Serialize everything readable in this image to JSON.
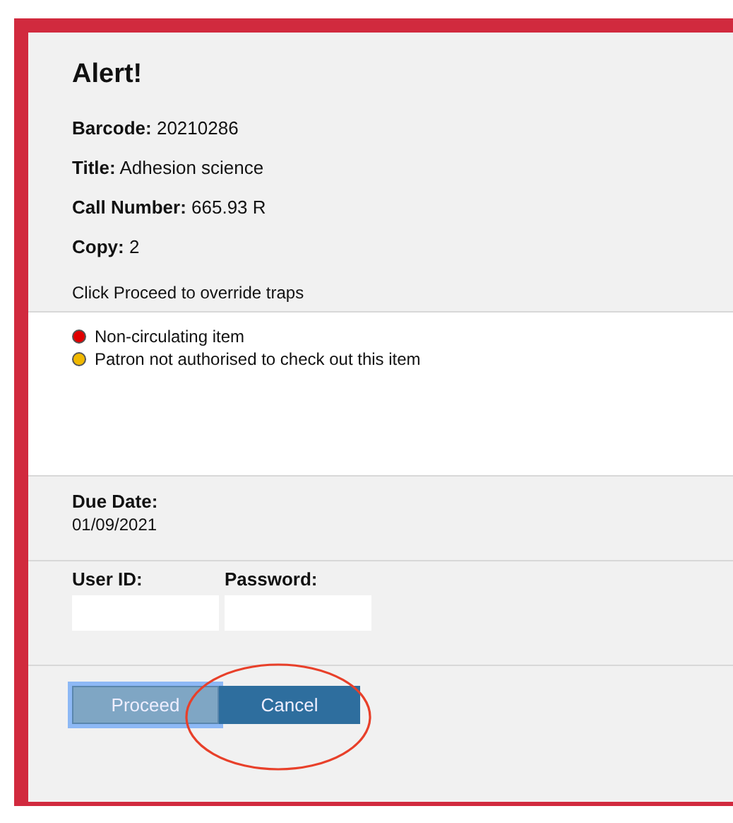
{
  "title": "Alert!",
  "details": [
    {
      "label": "Barcode:",
      "value": "20210286"
    },
    {
      "label": "Title:",
      "value": "Adhesion science"
    },
    {
      "label": "Call Number:",
      "value": "665.93 R"
    },
    {
      "label": "Copy:",
      "value": "2"
    }
  ],
  "instruction": "Click Proceed to override traps",
  "traps": [
    {
      "text": "Non-circulating item",
      "color": "#e00000"
    },
    {
      "text": "Patron not authorised to check out this item",
      "color": "#f0b800"
    }
  ],
  "due_date": {
    "label": "Due Date:",
    "value": "01/09/2021"
  },
  "fields": [
    {
      "label": "User ID:"
    },
    {
      "label": "Password:"
    }
  ],
  "buttons": [
    {
      "label": "Proceed",
      "focused": true
    },
    {
      "label": "Cancel",
      "focused": false
    }
  ],
  "annotations": [
    {
      "kind": "ellipse"
    }
  ]
}
